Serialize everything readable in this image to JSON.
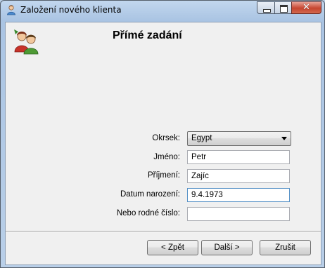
{
  "window": {
    "title": "Založení nového klienta",
    "controls": {
      "minimize": "–",
      "maximize": "□",
      "close": "✕"
    }
  },
  "heading": "Přímé zadání",
  "form": {
    "okrsek": {
      "label": "Okrsek:",
      "value": "Egypt"
    },
    "jmeno": {
      "label": "Jméno:",
      "value": "Petr"
    },
    "prijmeni": {
      "label": "Příjmení:",
      "value": "Zajíc"
    },
    "datum": {
      "label": "Datum narození:",
      "value": "9.4.1973"
    },
    "rodne_cislo": {
      "label": "Nebo rodné číslo:",
      "value": ""
    }
  },
  "buttons": {
    "back": "< Zpět",
    "next": "Další >",
    "cancel": "Zrušit"
  },
  "icons": {
    "title": "user-icon",
    "heading": "clients-icon"
  }
}
